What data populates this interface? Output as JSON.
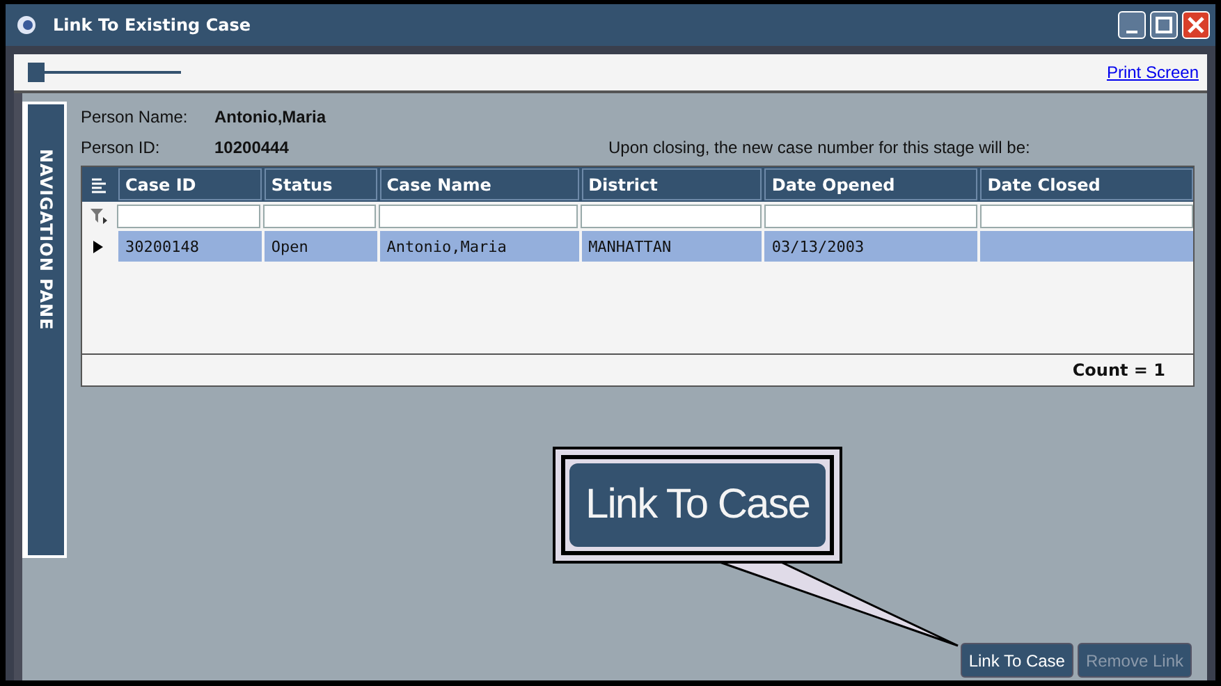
{
  "window": {
    "title": "Link To Existing Case"
  },
  "toolbar": {
    "zoom_slider": {
      "level": 0
    },
    "print_link": "Print Screen"
  },
  "navigation_pane": {
    "label": "NAVIGATION PANE"
  },
  "person": {
    "name_label": "Person Name:",
    "name": "Antonio,Maria",
    "id_label": "Person ID:",
    "id": "10200444",
    "note": "Upon closing, the new case number for this stage will be:"
  },
  "table": {
    "columns": [
      "Case ID",
      "Status",
      "Case Name",
      "District",
      "Date Opened",
      "Date Closed"
    ],
    "rows": [
      {
        "cells": [
          "30200148",
          "Open",
          "Antonio,Maria",
          "MANHATTAN",
          "03/13/2003",
          ""
        ],
        "selected": true
      }
    ],
    "count": "Count = 1"
  },
  "callout": {
    "label": "Link To Case"
  },
  "buttons": [
    {
      "label": "Link To Case",
      "disabled": false
    },
    {
      "label": "Remove Link",
      "disabled": true
    }
  ]
}
